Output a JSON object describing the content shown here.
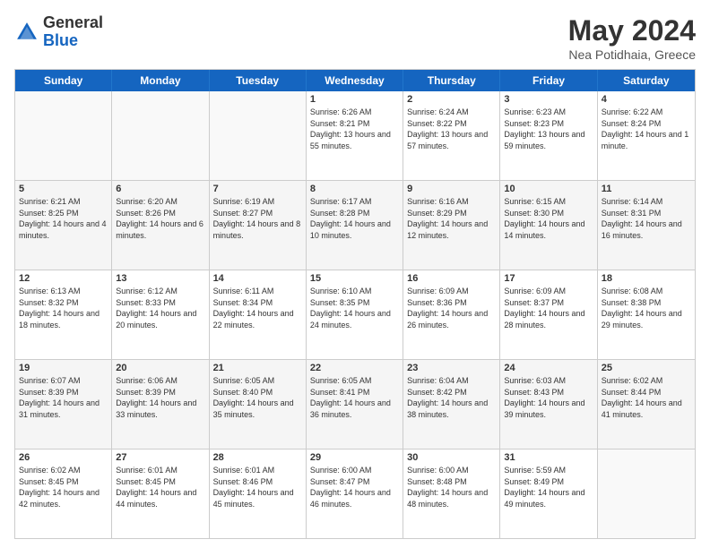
{
  "logo": {
    "general": "General",
    "blue": "Blue"
  },
  "header": {
    "title": "May 2024",
    "subtitle": "Nea Potidhaia, Greece"
  },
  "days_of_week": [
    "Sunday",
    "Monday",
    "Tuesday",
    "Wednesday",
    "Thursday",
    "Friday",
    "Saturday"
  ],
  "weeks": [
    {
      "cells": [
        {
          "day": "",
          "empty": true
        },
        {
          "day": "",
          "empty": true
        },
        {
          "day": "",
          "empty": true
        },
        {
          "day": "1",
          "sunrise": "Sunrise: 6:26 AM",
          "sunset": "Sunset: 8:21 PM",
          "daylight": "Daylight: 13 hours and 55 minutes."
        },
        {
          "day": "2",
          "sunrise": "Sunrise: 6:24 AM",
          "sunset": "Sunset: 8:22 PM",
          "daylight": "Daylight: 13 hours and 57 minutes."
        },
        {
          "day": "3",
          "sunrise": "Sunrise: 6:23 AM",
          "sunset": "Sunset: 8:23 PM",
          "daylight": "Daylight: 13 hours and 59 minutes."
        },
        {
          "day": "4",
          "sunrise": "Sunrise: 6:22 AM",
          "sunset": "Sunset: 8:24 PM",
          "daylight": "Daylight: 14 hours and 1 minute."
        }
      ]
    },
    {
      "cells": [
        {
          "day": "5",
          "sunrise": "Sunrise: 6:21 AM",
          "sunset": "Sunset: 8:25 PM",
          "daylight": "Daylight: 14 hours and 4 minutes."
        },
        {
          "day": "6",
          "sunrise": "Sunrise: 6:20 AM",
          "sunset": "Sunset: 8:26 PM",
          "daylight": "Daylight: 14 hours and 6 minutes."
        },
        {
          "day": "7",
          "sunrise": "Sunrise: 6:19 AM",
          "sunset": "Sunset: 8:27 PM",
          "daylight": "Daylight: 14 hours and 8 minutes."
        },
        {
          "day": "8",
          "sunrise": "Sunrise: 6:17 AM",
          "sunset": "Sunset: 8:28 PM",
          "daylight": "Daylight: 14 hours and 10 minutes."
        },
        {
          "day": "9",
          "sunrise": "Sunrise: 6:16 AM",
          "sunset": "Sunset: 8:29 PM",
          "daylight": "Daylight: 14 hours and 12 minutes."
        },
        {
          "day": "10",
          "sunrise": "Sunrise: 6:15 AM",
          "sunset": "Sunset: 8:30 PM",
          "daylight": "Daylight: 14 hours and 14 minutes."
        },
        {
          "day": "11",
          "sunrise": "Sunrise: 6:14 AM",
          "sunset": "Sunset: 8:31 PM",
          "daylight": "Daylight: 14 hours and 16 minutes."
        }
      ]
    },
    {
      "cells": [
        {
          "day": "12",
          "sunrise": "Sunrise: 6:13 AM",
          "sunset": "Sunset: 8:32 PM",
          "daylight": "Daylight: 14 hours and 18 minutes."
        },
        {
          "day": "13",
          "sunrise": "Sunrise: 6:12 AM",
          "sunset": "Sunset: 8:33 PM",
          "daylight": "Daylight: 14 hours and 20 minutes."
        },
        {
          "day": "14",
          "sunrise": "Sunrise: 6:11 AM",
          "sunset": "Sunset: 8:34 PM",
          "daylight": "Daylight: 14 hours and 22 minutes."
        },
        {
          "day": "15",
          "sunrise": "Sunrise: 6:10 AM",
          "sunset": "Sunset: 8:35 PM",
          "daylight": "Daylight: 14 hours and 24 minutes."
        },
        {
          "day": "16",
          "sunrise": "Sunrise: 6:09 AM",
          "sunset": "Sunset: 8:36 PM",
          "daylight": "Daylight: 14 hours and 26 minutes."
        },
        {
          "day": "17",
          "sunrise": "Sunrise: 6:09 AM",
          "sunset": "Sunset: 8:37 PM",
          "daylight": "Daylight: 14 hours and 28 minutes."
        },
        {
          "day": "18",
          "sunrise": "Sunrise: 6:08 AM",
          "sunset": "Sunset: 8:38 PM",
          "daylight": "Daylight: 14 hours and 29 minutes."
        }
      ]
    },
    {
      "cells": [
        {
          "day": "19",
          "sunrise": "Sunrise: 6:07 AM",
          "sunset": "Sunset: 8:39 PM",
          "daylight": "Daylight: 14 hours and 31 minutes."
        },
        {
          "day": "20",
          "sunrise": "Sunrise: 6:06 AM",
          "sunset": "Sunset: 8:39 PM",
          "daylight": "Daylight: 14 hours and 33 minutes."
        },
        {
          "day": "21",
          "sunrise": "Sunrise: 6:05 AM",
          "sunset": "Sunset: 8:40 PM",
          "daylight": "Daylight: 14 hours and 35 minutes."
        },
        {
          "day": "22",
          "sunrise": "Sunrise: 6:05 AM",
          "sunset": "Sunset: 8:41 PM",
          "daylight": "Daylight: 14 hours and 36 minutes."
        },
        {
          "day": "23",
          "sunrise": "Sunrise: 6:04 AM",
          "sunset": "Sunset: 8:42 PM",
          "daylight": "Daylight: 14 hours and 38 minutes."
        },
        {
          "day": "24",
          "sunrise": "Sunrise: 6:03 AM",
          "sunset": "Sunset: 8:43 PM",
          "daylight": "Daylight: 14 hours and 39 minutes."
        },
        {
          "day": "25",
          "sunrise": "Sunrise: 6:02 AM",
          "sunset": "Sunset: 8:44 PM",
          "daylight": "Daylight: 14 hours and 41 minutes."
        }
      ]
    },
    {
      "cells": [
        {
          "day": "26",
          "sunrise": "Sunrise: 6:02 AM",
          "sunset": "Sunset: 8:45 PM",
          "daylight": "Daylight: 14 hours and 42 minutes."
        },
        {
          "day": "27",
          "sunrise": "Sunrise: 6:01 AM",
          "sunset": "Sunset: 8:45 PM",
          "daylight": "Daylight: 14 hours and 44 minutes."
        },
        {
          "day": "28",
          "sunrise": "Sunrise: 6:01 AM",
          "sunset": "Sunset: 8:46 PM",
          "daylight": "Daylight: 14 hours and 45 minutes."
        },
        {
          "day": "29",
          "sunrise": "Sunrise: 6:00 AM",
          "sunset": "Sunset: 8:47 PM",
          "daylight": "Daylight: 14 hours and 46 minutes."
        },
        {
          "day": "30",
          "sunrise": "Sunrise: 6:00 AM",
          "sunset": "Sunset: 8:48 PM",
          "daylight": "Daylight: 14 hours and 48 minutes."
        },
        {
          "day": "31",
          "sunrise": "Sunrise: 5:59 AM",
          "sunset": "Sunset: 8:49 PM",
          "daylight": "Daylight: 14 hours and 49 minutes."
        },
        {
          "day": "",
          "empty": true
        }
      ]
    }
  ]
}
